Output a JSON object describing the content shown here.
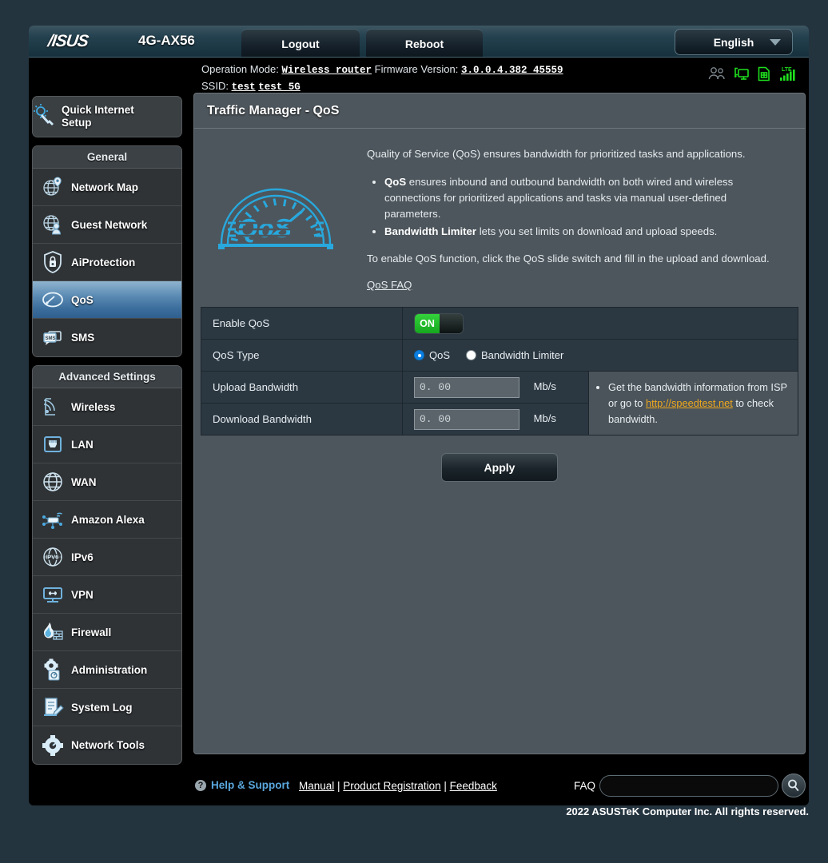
{
  "header": {
    "brand": "/ISUS",
    "model": "4G-AX56",
    "logout_label": "Logout",
    "reboot_label": "Reboot",
    "language": "English"
  },
  "status": {
    "operation_mode_label": "Operation Mode:",
    "operation_mode_value": "Wireless router",
    "firmware_label": "Firmware Version:",
    "firmware_value": "3.0.0.4.382_45559",
    "ssid_label": "SSID:",
    "ssid_1": "test",
    "ssid_2": "test_5G",
    "icons": [
      "clients-icon",
      "usb-device-icon",
      "sim-card-icon",
      "lte-signal-icon"
    ]
  },
  "sidebar": {
    "quick_internet_setup": "Quick Internet\nSetup",
    "quick_internet_setup_line1": "Quick Internet",
    "quick_internet_setup_line2": "Setup",
    "general_header": "General",
    "general_items": [
      {
        "label": "Network Map",
        "icon": "network-map-icon",
        "active": false
      },
      {
        "label": "Guest Network",
        "icon": "guest-network-icon",
        "active": false
      },
      {
        "label": "AiProtection",
        "icon": "shield-lock-icon",
        "active": false
      },
      {
        "label": "QoS",
        "icon": "qos-gauge-icon",
        "active": true
      },
      {
        "label": "SMS",
        "icon": "sms-icon",
        "active": false
      }
    ],
    "advanced_header": "Advanced Settings",
    "advanced_items": [
      {
        "label": "Wireless",
        "icon": "wireless-icon"
      },
      {
        "label": "LAN",
        "icon": "lan-port-icon"
      },
      {
        "label": "WAN",
        "icon": "globe-icon"
      },
      {
        "label": "Amazon Alexa",
        "icon": "alexa-icon"
      },
      {
        "label": "IPv6",
        "icon": "ipv6-icon"
      },
      {
        "label": "VPN",
        "icon": "vpn-icon"
      },
      {
        "label": "Firewall",
        "icon": "firewall-flame-icon"
      },
      {
        "label": "Administration",
        "icon": "administration-gear-icon"
      },
      {
        "label": "System Log",
        "icon": "system-log-icon"
      },
      {
        "label": "Network Tools",
        "icon": "network-tools-icon"
      }
    ]
  },
  "main": {
    "title": "Traffic Manager - QoS",
    "logo_icon": "qos-speedometer-logo",
    "intro_paragraph": "Quality of Service (QoS) ensures bandwidth for prioritized tasks and applications.",
    "bullets": [
      {
        "bold": "QoS",
        "text": " ensures inbound and outbound bandwidth on both wired and wireless connections for prioritized applications and tasks via manual user-defined parameters."
      },
      {
        "bold": "Bandwidth Limiter",
        "text": " lets you set limits on download and upload speeds."
      }
    ],
    "closing_paragraph": "To enable QoS function, click the QoS slide switch and fill in the upload and download.",
    "faq_link": "QoS FAQ",
    "form": {
      "enable_qos_label": "Enable QoS",
      "enable_qos_state": "ON",
      "qos_type_label": "QoS Type",
      "qos_type_options": [
        {
          "label": "QoS",
          "selected": true
        },
        {
          "label": "Bandwidth Limiter",
          "selected": false
        }
      ],
      "upload_label": "Upload Bandwidth",
      "upload_value": "0. 00",
      "download_label": "Download Bandwidth",
      "download_value": "0. 00",
      "unit": "Mb/s",
      "hint_prefix": "Get the bandwidth information from ISP or go to ",
      "hint_link": "http://speedtest.net",
      "hint_suffix": " to check bandwidth."
    },
    "apply_label": "Apply"
  },
  "footer": {
    "help_label": "Help & Support",
    "manual": "Manual",
    "sep1": " | ",
    "product_registration": "Product Registration",
    "sep2": " | ",
    "feedback": "Feedback",
    "faq_label": "FAQ",
    "faq_placeholder": "",
    "search_icon": "magnifier-icon",
    "copyright": "2022 ASUSTeK Computer Inc. All rights reserved."
  },
  "colors": {
    "accent_blue": "#0b7fe0",
    "toggle_green": "#16a81e",
    "link_orange": "#f0a81e",
    "help_blue": "#5aa7de",
    "logo_cyan": "#29a9e0",
    "page_bg": "#24343f"
  }
}
